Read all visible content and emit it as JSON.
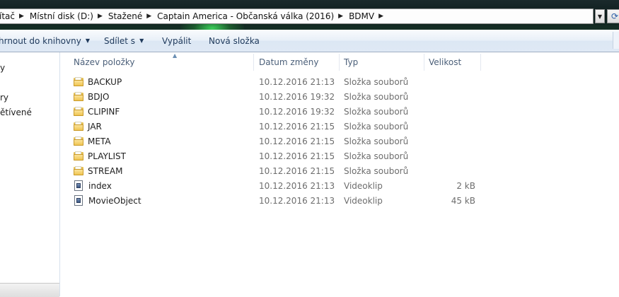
{
  "address": {
    "crumbs": [
      "ítač",
      "Místní disk (D:)",
      "Stažené",
      "Captain America - Občanská válka (2016)",
      "BDMV"
    ]
  },
  "toolbar": {
    "include_label": "hrnout do knihovny",
    "share_label": "Sdílet s",
    "burn_label": "Vypálit",
    "new_folder_label": "Nová složka"
  },
  "nav": {
    "items": [
      "y",
      "ry",
      "ětívené"
    ]
  },
  "columns": {
    "name": "Název položky",
    "date": "Datum změny",
    "type": "Typ",
    "size": "Velikost"
  },
  "files": [
    {
      "name": "BACKUP",
      "date": "10.12.2016 21:13",
      "type": "Složka souborů",
      "size": "",
      "icon": "folder-icon"
    },
    {
      "name": "BDJO",
      "date": "10.12.2016 19:32",
      "type": "Složka souborů",
      "size": "",
      "icon": "folder-icon"
    },
    {
      "name": "CLIPINF",
      "date": "10.12.2016 19:32",
      "type": "Složka souborů",
      "size": "",
      "icon": "folder-icon"
    },
    {
      "name": "JAR",
      "date": "10.12.2016 21:15",
      "type": "Složka souborů",
      "size": "",
      "icon": "folder-icon"
    },
    {
      "name": "META",
      "date": "10.12.2016 21:15",
      "type": "Složka souborů",
      "size": "",
      "icon": "folder-icon"
    },
    {
      "name": "PLAYLIST",
      "date": "10.12.2016 21:15",
      "type": "Složka souborů",
      "size": "",
      "icon": "folder-icon"
    },
    {
      "name": "STREAM",
      "date": "10.12.2016 21:15",
      "type": "Složka souborů",
      "size": "",
      "icon": "folder-icon"
    },
    {
      "name": "index",
      "date": "10.12.2016 21:13",
      "type": "Videoklip",
      "size": "2 kB",
      "icon": "video-file-icon"
    },
    {
      "name": "MovieObject",
      "date": "10.12.2016 21:13",
      "type": "Videoklip",
      "size": "45 kB",
      "icon": "video-file-icon"
    }
  ]
}
